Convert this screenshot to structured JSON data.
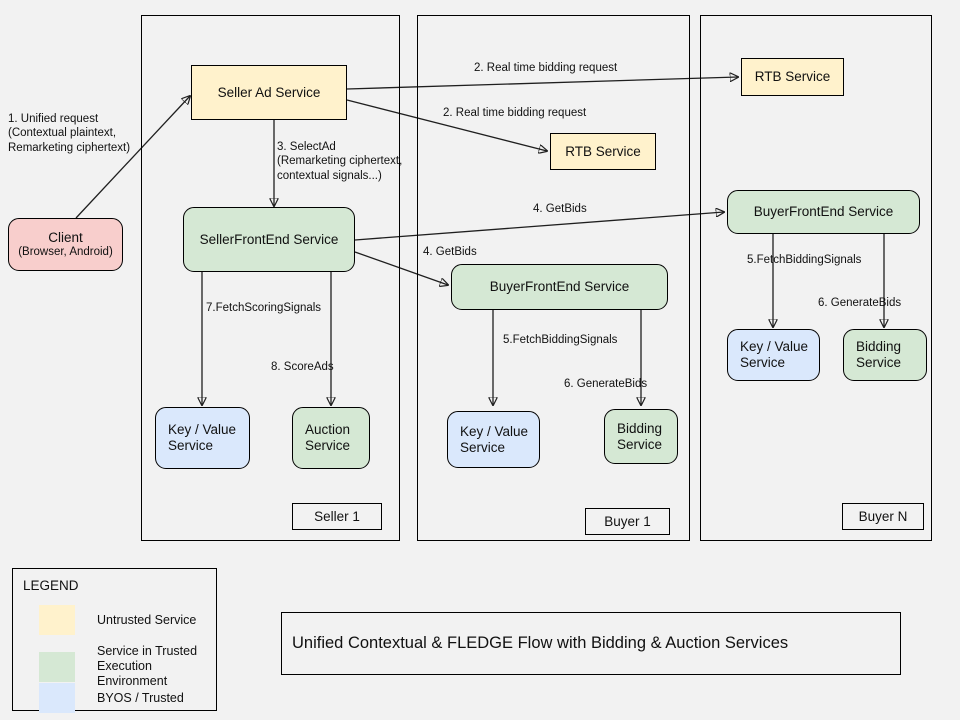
{
  "diagram": {
    "title": "Unified Contextual & FLEDGE Flow with Bidding & Auction Services",
    "background_color": "#f2f2f2",
    "colors": {
      "untrusted": "#fff2cc",
      "tee": "#d5e8d4",
      "byos": "#dae8fc",
      "client": "#f8cecc",
      "stroke": "#000000"
    }
  },
  "panels": [
    {
      "id": "seller1",
      "tag": "Seller 1"
    },
    {
      "id": "buyer1",
      "tag": "Buyer 1"
    },
    {
      "id": "buyerN",
      "tag": "Buyer N"
    }
  ],
  "nodes": {
    "client": {
      "label": "Client",
      "sublabel": "(Browser, Android)",
      "fill": "client"
    },
    "seller_ad_service": {
      "label": "Seller Ad Service",
      "fill": "untrusted"
    },
    "seller_frontend": {
      "label": "SellerFrontEnd Service",
      "fill": "tee"
    },
    "seller_kv": {
      "label_line1": "Key / Value",
      "label_line2": "Service",
      "fill": "byos"
    },
    "auction_service": {
      "label_line1": "Auction",
      "label_line2": "Service",
      "fill": "tee"
    },
    "rtb_top": {
      "label": "RTB  Service",
      "fill": "untrusted"
    },
    "rtb_mid": {
      "label": "RTB Service",
      "fill": "untrusted"
    },
    "buyer1_frontend": {
      "label": "BuyerFrontEnd Service",
      "fill": "tee"
    },
    "buyer1_kv": {
      "label_line1": "Key / Value",
      "label_line2": "Service",
      "fill": "byos"
    },
    "buyer1_bidding": {
      "label_line1": "Bidding",
      "label_line2": "Service",
      "fill": "tee"
    },
    "buyerN_frontend": {
      "label": "BuyerFrontEnd Service",
      "fill": "tee"
    },
    "buyerN_kv": {
      "label_line1": "Key / Value",
      "label_line2": "Service",
      "fill": "byos"
    },
    "buyerN_bidding": {
      "label_line1": "Bidding",
      "label_line2": "Service",
      "fill": "tee"
    }
  },
  "edge_labels": {
    "unified_request": "1. Unified request\n(Contextual plaintext,\nRemarketing ciphertext)",
    "rtb_top": "2. Real time bidding request",
    "rtb_mid": "2. Real time bidding request",
    "select_ad": "3. SelectAd\n(Remarketing ciphertext,\ncontextual signals...)",
    "getbids_top": "4. GetBids",
    "getbids_mid": "4. GetBids",
    "fetch_scoring_signals": "7.FetchScoringSignals",
    "score_ads": "8. ScoreAds",
    "buyer1_fetch_bidding": "5.FetchBiddingSignals",
    "buyer1_generate_bids": "6. GenerateBids",
    "buyerN_fetch_bidding": "5.FetchBiddingSignals",
    "buyerN_generate_bids": "6. GenerateBids"
  },
  "legend": {
    "title": "LEGEND",
    "items": [
      {
        "swatch": "#fff2cc",
        "label": "Untrusted Service"
      },
      {
        "swatch": "#d5e8d4",
        "label": "Service in Trusted\nExecution Environment"
      },
      {
        "swatch": "#dae8fc",
        "label": "BYOS / Trusted"
      }
    ]
  }
}
